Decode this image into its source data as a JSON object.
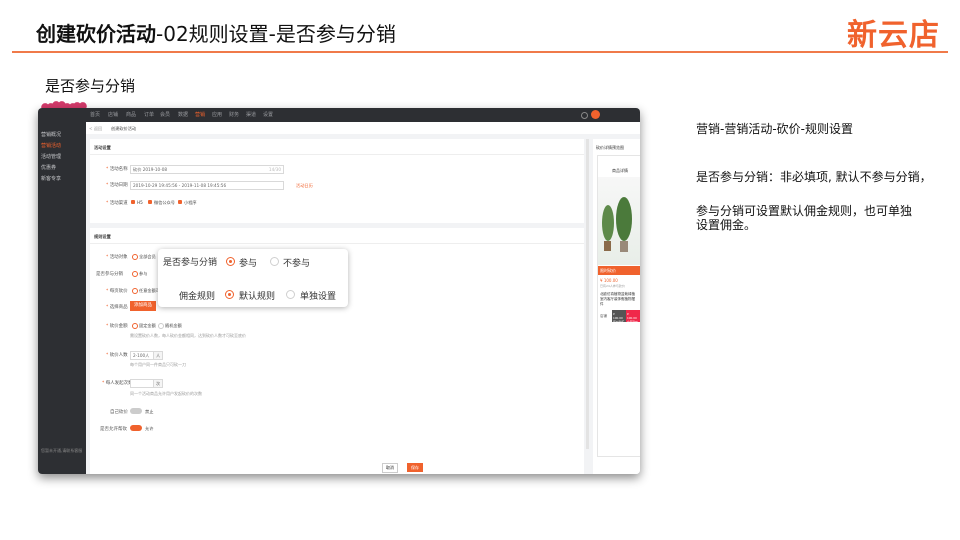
{
  "slide": {
    "title_bold": "创建砍价活动",
    "title_rest": "-02规则设置-是否参与分销",
    "brand": "新云店",
    "section_heading": "是否参与分销"
  },
  "notes": {
    "breadcrumb": "营销-营销活动-砍价-规则设置",
    "line1": "是否参与分销：非必填项, 默认不参与分销，",
    "line2": "参与分销可设置默认佣金规则，也可单独",
    "line3": "设置佣金。"
  },
  "app": {
    "top_nav": [
      "首页",
      "店铺",
      "商品",
      "订单",
      "会员",
      "数据",
      "营销",
      "应用",
      "财务",
      "渠道",
      "设置"
    ],
    "sidebar": [
      "营销概况",
      "营销活动",
      "活动管理",
      "优惠券",
      "新客专享"
    ],
    "sidebar_footer": "您暂未开通,请联系客服",
    "back_link": "< 返回",
    "page_heading": "创建砍价活动",
    "activity_card": {
      "title": "活动设置",
      "name_label": "活动名称",
      "name_value": "砍价 2019-10-08",
      "name_count": "14/30",
      "date_label": "活动日期",
      "date_value": "2019-10-29 19:45:56 - 2019-11-08 19:45:56",
      "date_link": "活动日历",
      "channel_label": "活动渠道",
      "channels": [
        "H5",
        "微信公众号",
        "小程序"
      ]
    },
    "rules_card": {
      "title": "规则设置",
      "goods_label": "活动对象",
      "goods_value": "全部会员",
      "dist_label": "是否参与分销",
      "dist_value": "参与",
      "ref_label": "每页砍价",
      "ref_value": "任意金额可参与",
      "select_label": "选择商品",
      "select_button": "添加商品",
      "bargain_label": "砍价金额",
      "bargain_options": [
        "固定金额",
        "随机金额"
      ],
      "bargain_hint": "需设置砍价人数，每人砍价金额相同，达到砍价人数才可砍至底价",
      "people_label": "砍价人数",
      "people_value": "2-100人",
      "people_unit": "人",
      "people_hint": "每个用户同一件商品只可砍一刀",
      "limit_label": "每人发起次数",
      "limit_unit": "次",
      "limit_hint": "同一个活动商品允许用户发起砍价的次数",
      "self_label": "自己砍价",
      "self_value": "禁止",
      "share_label": "是否允许帮砍",
      "share_value": "允许"
    },
    "popup": {
      "row1_label": "是否参与分销",
      "row1_options": [
        "参与",
        "不参与"
      ],
      "row2_label": "佣金规则",
      "row2_options": [
        "默认规则",
        "单独设置"
      ]
    },
    "preview": {
      "title": "砍价详情预览图",
      "phone_header": "商品详情",
      "banner": "限时砍价",
      "price_tag": "¥ 100.00",
      "price_note": "已有24人参与砍价",
      "product_name": "北欧仿真植物盆栽绿植室内客厅装饰假植物摆件",
      "btn_left": "¥ 100.00 原价购买",
      "btn_right": "¥ 100.00 立即砍价",
      "home": "店铺"
    },
    "footer_buttons": [
      "取消",
      "保存"
    ]
  },
  "colors": {
    "accent": "#f0622d",
    "dark_nav": "#2d2f33",
    "decor": "#d23a6a"
  }
}
